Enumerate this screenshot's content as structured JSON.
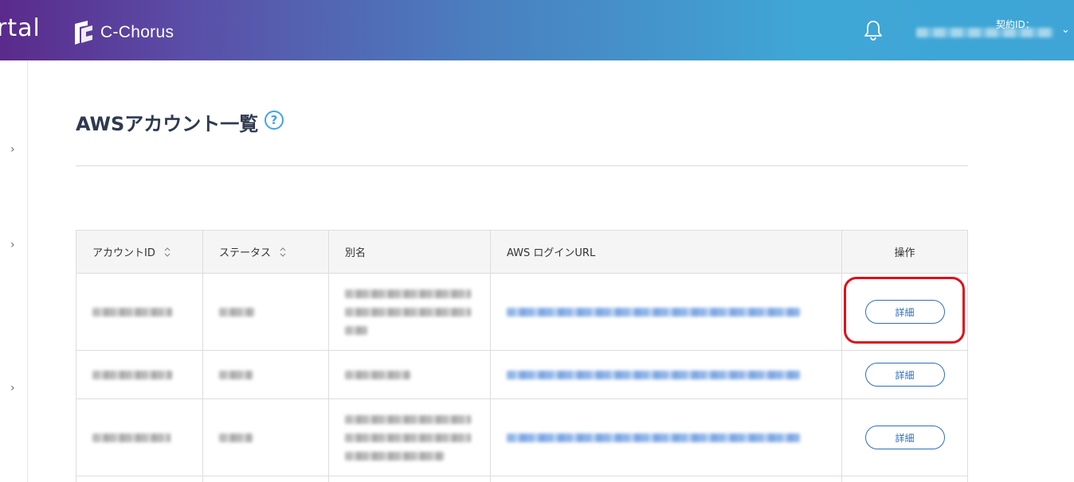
{
  "header": {
    "portal_text": "rtal",
    "logo_text": "C-Chorus",
    "contract_label": "契約ID：",
    "colors": {
      "gradient_start": "#5a2a8c",
      "gradient_end": "#3ea5d6"
    },
    "icons": {
      "bell": "bell-icon",
      "chevron": "chevron-down-icon"
    }
  },
  "sidebar": {
    "arrows": [
      "›",
      "›",
      "›"
    ]
  },
  "page": {
    "title": "AWSアカウント一覧",
    "help_symbol": "?"
  },
  "table": {
    "columns": [
      {
        "label": "アカウントID",
        "sortable": true
      },
      {
        "label": "ステータス",
        "sortable": true
      },
      {
        "label": "別名",
        "sortable": false
      },
      {
        "label": "AWS ログインURL",
        "sortable": false
      },
      {
        "label": "操作",
        "sortable": false
      }
    ],
    "rows": [
      {
        "action_label": "詳細",
        "redacted": true,
        "highlighted": true
      },
      {
        "action_label": "詳細",
        "redacted": true,
        "highlighted": false
      },
      {
        "action_label": "詳細",
        "redacted": true,
        "highlighted": false
      }
    ]
  },
  "colors": {
    "accent": "#2e6fbf",
    "help": "#3ea5e6",
    "highlight": "#e0101a"
  }
}
